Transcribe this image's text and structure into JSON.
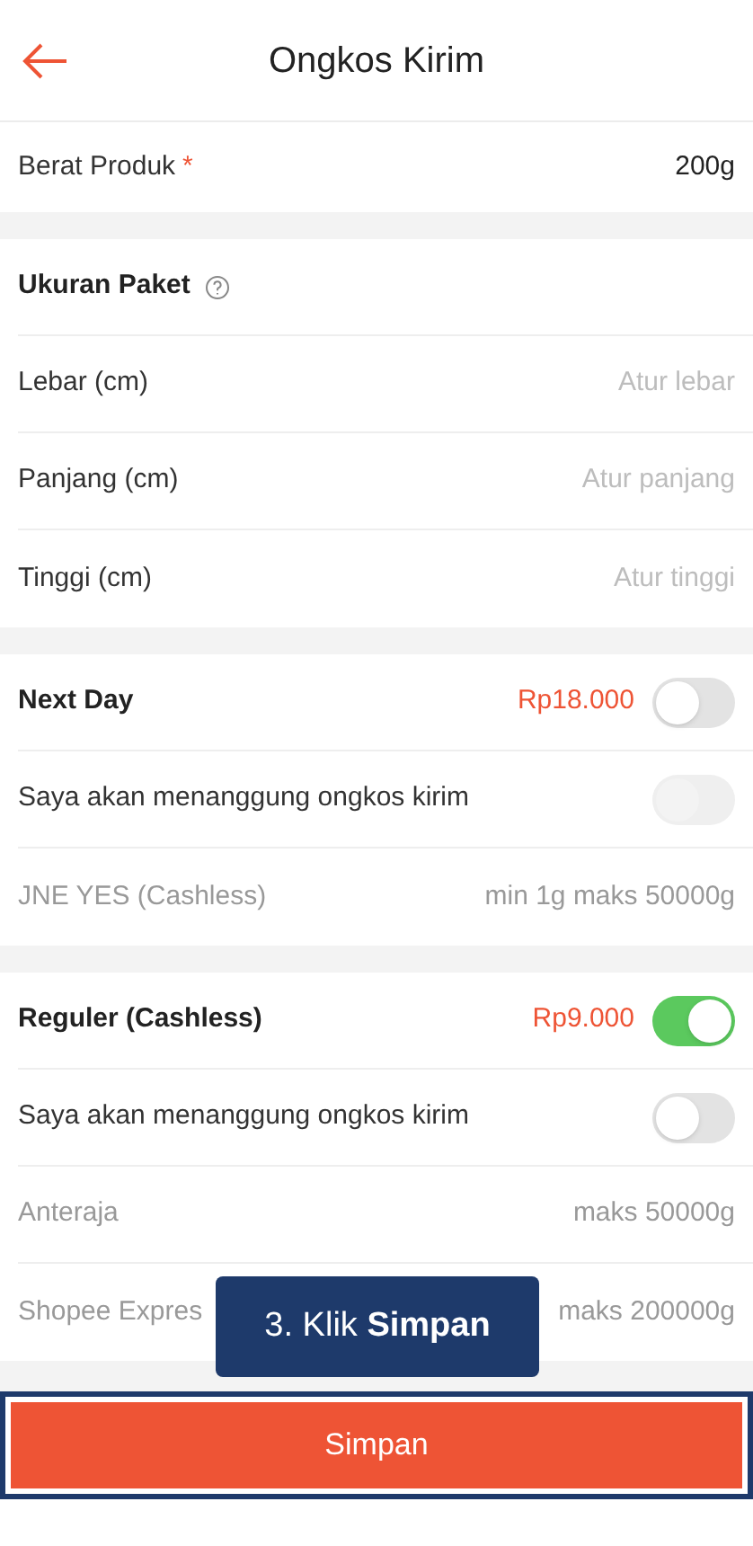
{
  "header": {
    "title": "Ongkos Kirim"
  },
  "weight": {
    "label": "Berat Produk",
    "required_mark": "*",
    "value": "200g"
  },
  "package": {
    "title": "Ukuran Paket",
    "fields": [
      {
        "label": "Lebar (cm)",
        "placeholder": "Atur lebar"
      },
      {
        "label": "Panjang (cm)",
        "placeholder": "Atur panjang"
      },
      {
        "label": "Tinggi (cm)",
        "placeholder": "Atur tinggi"
      }
    ]
  },
  "shipping": [
    {
      "rows": [
        {
          "kind": "service",
          "label": "Next Day",
          "price": "Rp18.000",
          "on": false,
          "disabled": false
        },
        {
          "kind": "bear",
          "label": "Saya akan menanggung ongkos kirim",
          "on": false,
          "disabled": true
        },
        {
          "kind": "courier",
          "label": "JNE YES (Cashless)",
          "limit": "min 1g maks 50000g"
        }
      ]
    },
    {
      "rows": [
        {
          "kind": "service",
          "label": "Reguler (Cashless)",
          "price": "Rp9.000",
          "on": true,
          "disabled": false
        },
        {
          "kind": "bear",
          "label": "Saya akan menanggung ongkos kirim",
          "on": false,
          "disabled": false
        },
        {
          "kind": "courier",
          "label": "Anteraja",
          "limit": "maks 50000g"
        },
        {
          "kind": "courier",
          "label": "Shopee Expres",
          "limit": "maks 200000g"
        }
      ]
    }
  ],
  "tooltip": {
    "text": "3. Klik **Simpan**"
  },
  "save_button": {
    "label": "Simpan",
    "highlighted": true
  }
}
